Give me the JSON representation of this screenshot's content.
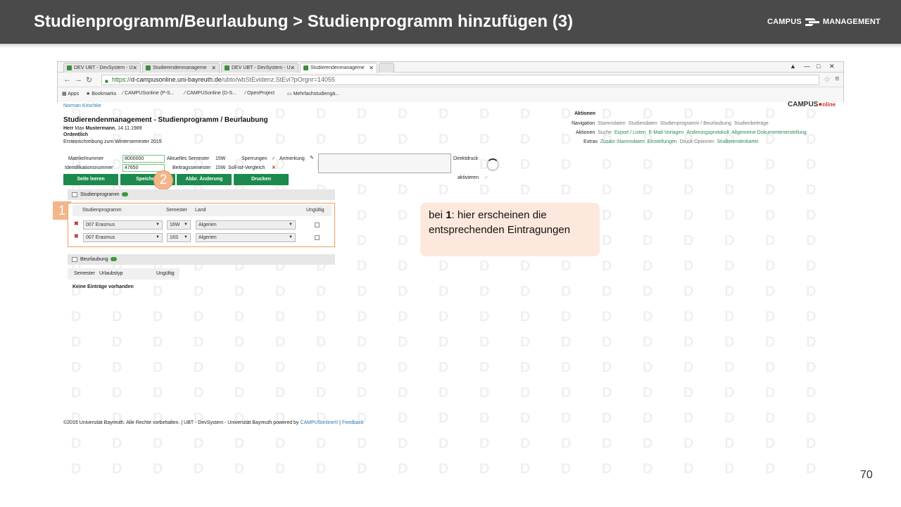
{
  "slide": {
    "title": "Studienprogramm/Beurlaubung > Studienprogramm hinzufügen (3)",
    "logo_left": "CAMPUS",
    "logo_right": "MANAGEMENT",
    "page_number": "70"
  },
  "browser": {
    "tabs": [
      "DEV UBT - DevSystem - U",
      "Studierendenmanageme",
      "DEV UBT - DevSystem - U",
      "Studierendenmanageme"
    ],
    "active_tab": 3,
    "url_scheme": "https://",
    "url_domain": "d-campusonline.uni-bayreuth.de",
    "url_path": "/ubto/wbStEvidenz.StEvi?pOrgnr=14055",
    "bookmarks": [
      "Apps",
      "Bookmarks",
      "CAMPUSonline (P-S...",
      "CAMPUSonline (D-S...",
      "OpenProject",
      "Mehrfachstudiengä..."
    ]
  },
  "page": {
    "user": "Norman Krischke",
    "title": "Studierendenmanagement - Studienprogramm / Beurlaubung",
    "person_prefix": "Herr",
    "person_first": "Max",
    "person_last": "Mustermann",
    "birthdate": "14.11.1989",
    "status": "Ordentlich",
    "enrollment": "Ersteinschreibung zum Wintersemester 2015",
    "brand": "CAMPUS",
    "brand_suffix": "nline"
  },
  "form": {
    "matrikel_label": "Matrikelnummer",
    "matrikel_value": "8000000",
    "ident_label": "Identifikationsnummer",
    "ident_value": "47650",
    "akt_sem_label": "Aktuelles Semester",
    "akt_sem_value": "15W",
    "beitrag_label": "Beitragssemester",
    "beitrag_value": "15W",
    "sperrungen_label": "Sperrungen",
    "anmerkung_label": "Anmerkung",
    "sollist_label": "Soll-Ist-Vergleich",
    "direktdruck_label": "Direktdruck",
    "aktivieren_label": "aktivieren"
  },
  "buttons": {
    "seite_leeren": "Seite leeren",
    "speichern": "Speichern",
    "abbr": "Abbr. Änderung",
    "drucken": "Drucken"
  },
  "markers": {
    "one": "1",
    "two": "2"
  },
  "studienprogramm": {
    "section_title": "Studienprogramm",
    "columns": [
      "Studienprogramm",
      "Semester",
      "Land",
      "Ungültig"
    ],
    "rows": [
      {
        "program": "007 Erasmus",
        "semester": "16W",
        "land": "Algerien"
      },
      {
        "program": "007 Erasmus",
        "semester": "16S",
        "land": "Algerien"
      }
    ]
  },
  "beurlaubung": {
    "section_title": "Beurlaubung",
    "columns": [
      "Semester",
      "Urlaubstyp",
      "Ungültig"
    ],
    "empty": "Keine Einträge vorhanden"
  },
  "aktionen": {
    "title": "Aktionen",
    "nav_label": "Navigation",
    "nav_items": [
      "Stammdaten",
      "Studiendaten",
      "Studienprogramm / Beurlaubung",
      "Studienbeiträge"
    ],
    "akt_label": "Aktionen",
    "akt_items": [
      "Suche",
      "Export / Listen",
      "E-Mail-Vorlagen",
      "Änderungsprotokoll",
      "Allgemeine Dokumentenerstellung"
    ],
    "extras_label": "Extras",
    "extras_items": [
      "Zusatz-Stammdaten",
      "Einstellungen",
      "Druck-Optionen",
      "Studierendenkartei"
    ]
  },
  "footer": {
    "text": "©2015 Universität Bayreuth. Alle Rechte vorbehalten. | UBT - DevSystem - Universität Bayreuth powered by",
    "link1": "CAMPUSonline®",
    "sep": "|",
    "link2": "Feedback"
  },
  "callout": {
    "prefix": "bei ",
    "num": "1",
    "text": ": hier erscheinen die entsprechenden Eintragungen"
  },
  "watermark_letter": "D",
  "colors": {
    "header_bg": "#4a4a4a",
    "button_green": "#1b8a4c",
    "marker_orange": "#f2b68a",
    "callout_bg": "#fce8dc",
    "link_green": "#2a8a55"
  }
}
